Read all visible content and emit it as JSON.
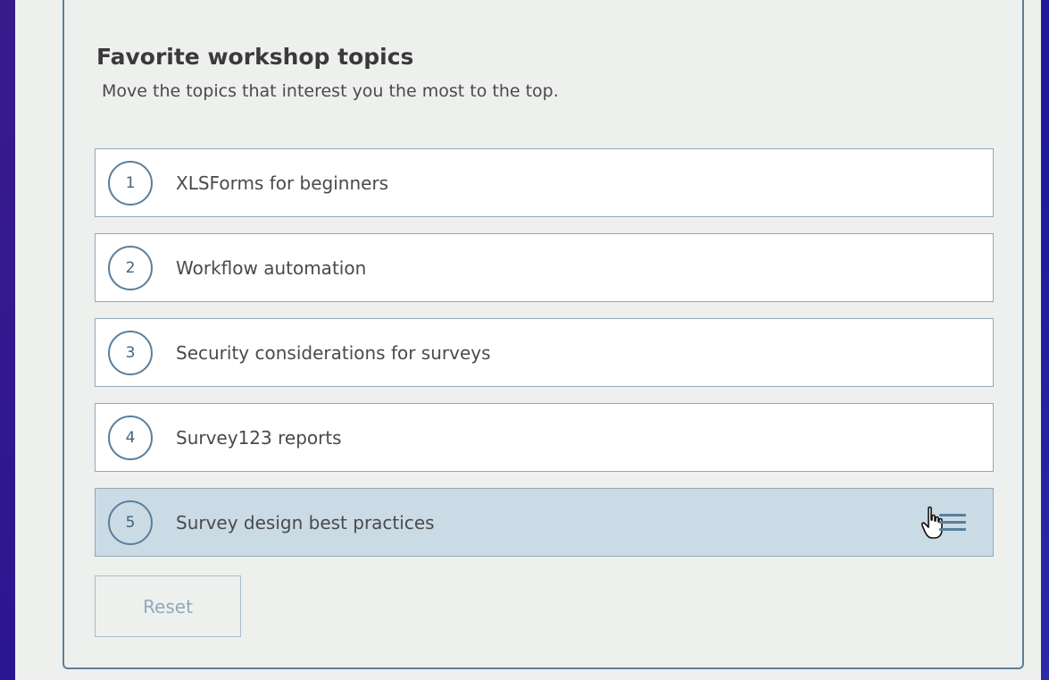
{
  "question": {
    "title": "Favorite workshop topics",
    "hint": "Move the topics that interest you the most to the top."
  },
  "ranking": {
    "items": [
      {
        "rank": "1",
        "label": "XLSForms for beginners"
      },
      {
        "rank": "2",
        "label": "Workflow automation"
      },
      {
        "rank": "3",
        "label": "Security considerations for surveys"
      },
      {
        "rank": "4",
        "label": "Survey123 reports"
      },
      {
        "rank": "5",
        "label": "Survey design best practices"
      }
    ],
    "active_index": 4
  },
  "controls": {
    "reset_label": "Reset"
  },
  "icons": {
    "drag_handle": "drag-handle-icon",
    "cursor": "hand-pointer-cursor-icon"
  },
  "colors": {
    "accent": "#5a7f9c",
    "item_border": "#8fa9bd",
    "active_item_bg": "#cbdbe5",
    "card_bg": "#eef0ee"
  }
}
